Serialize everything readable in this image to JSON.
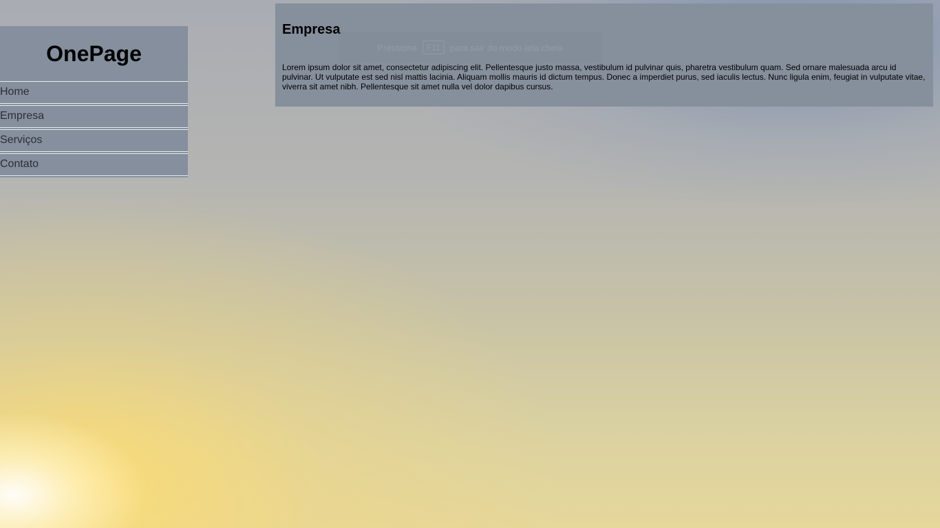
{
  "sidebar": {
    "brand": "OnePage",
    "items": [
      {
        "label": "Home"
      },
      {
        "label": "Empresa"
      },
      {
        "label": "Serviços"
      },
      {
        "label": "Contato"
      }
    ]
  },
  "panel": {
    "title": "Empresa",
    "body": "Lorem ipsum dolor sit amet, consectetur adipiscing elit. Pellentesque justo massa, vestibulum id pulvinar quis, pharetra vestibulum quam. Sed ornare malesuada arcu id pulvinar. Ut vulputate est sed nisl mattis lacinia. Aliquam mollis mauris id dictum tempus. Donec a imperdiet purus, sed iaculis lectus. Nunc ligula enim, feugiat in vulputate vitae, viverra sit amet nibh. Pellentesque sit amet nulla vel dolor dapibus cursus."
  },
  "fullscreen_hint": {
    "prefix": "Pressione",
    "key": "F11",
    "suffix": "para sair do modo tela cheia"
  },
  "colors": {
    "panel_bg": "#868f9c",
    "sidebar_bg": "#858f9d"
  }
}
